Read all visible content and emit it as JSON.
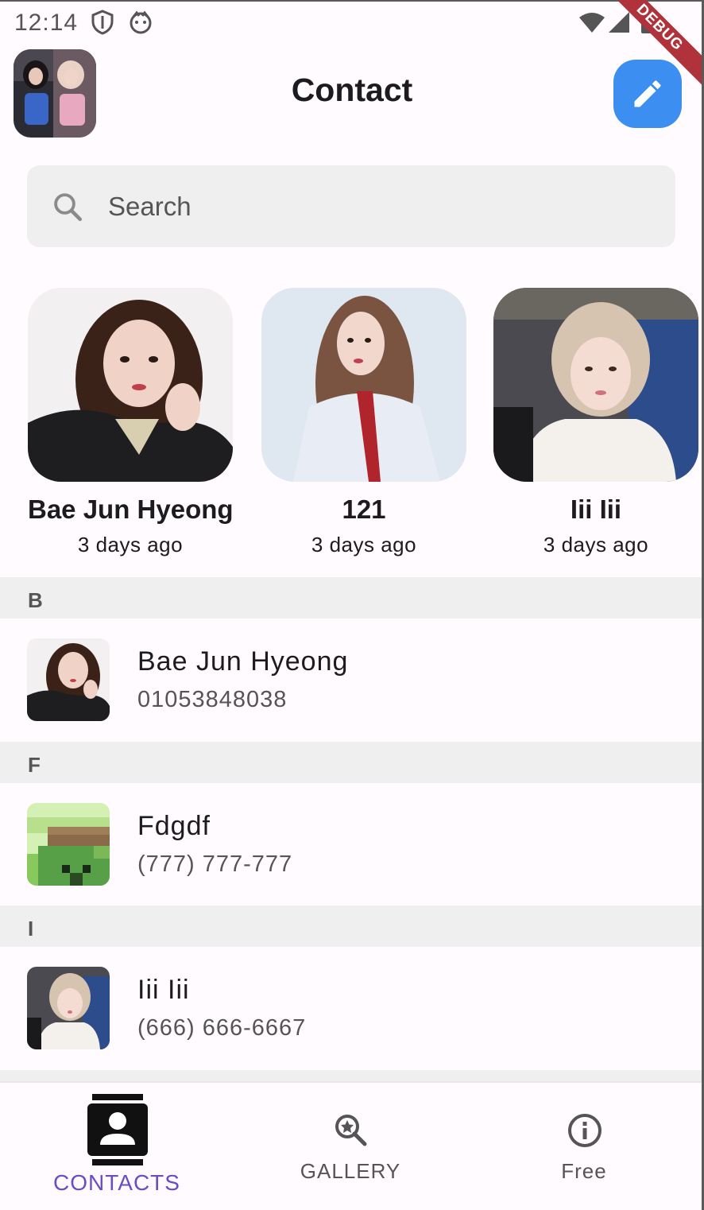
{
  "status_bar": {
    "time": "12:14",
    "debug_label": "DEBUG",
    "icons": [
      "shield-icon",
      "face-icon",
      "wifi-icon",
      "signal-icon",
      "battery-icon"
    ]
  },
  "header": {
    "title": "Contact",
    "avatar_icon": "profile-avatar",
    "edit_icon": "pencil-icon"
  },
  "search": {
    "placeholder": "Search",
    "icon": "search-icon"
  },
  "recent": [
    {
      "name": "Bae Jun Hyeong",
      "time": "3 days ago"
    },
    {
      "name": "121",
      "time": "3 days ago"
    },
    {
      "name": "Iii Iii",
      "time": "3 days ago"
    }
  ],
  "sections": [
    {
      "letter": "B",
      "contact": {
        "name": "Bae Jun Hyeong",
        "phone": "01053848038"
      }
    },
    {
      "letter": "F",
      "contact": {
        "name": "Fdgdf",
        "phone": "(777) 777-777"
      }
    },
    {
      "letter": "I",
      "contact": {
        "name": "Iii Iii",
        "phone": "(666) 666-6667"
      }
    }
  ],
  "bottom_nav": {
    "items": [
      {
        "label": "CONTACTS",
        "icon": "contacts-icon",
        "active": true
      },
      {
        "label": "GALLERY",
        "icon": "image-search-icon",
        "active": false
      },
      {
        "label": "Free",
        "icon": "info-icon",
        "active": false
      }
    ]
  },
  "colors": {
    "accent": "#3c8ef0",
    "active_nav": "#6a4cc8",
    "inactive_nav": "#555555",
    "debug": "#b0333c"
  }
}
